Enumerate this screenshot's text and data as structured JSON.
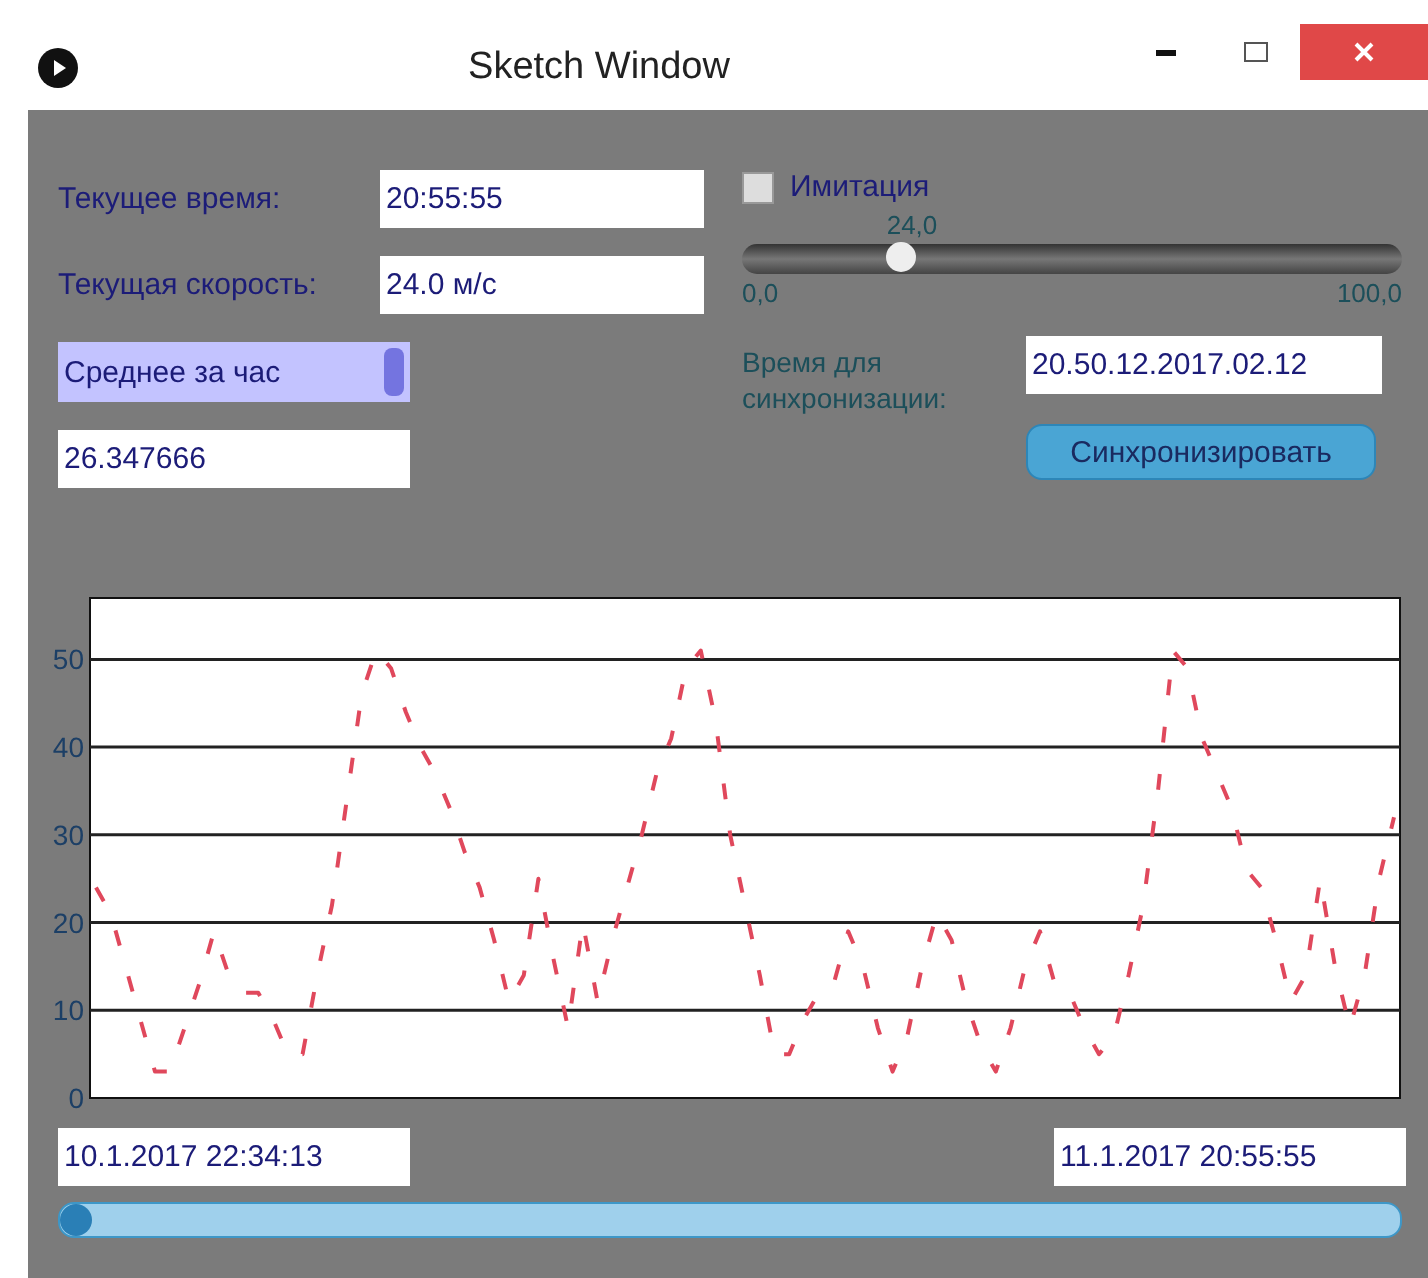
{
  "window": {
    "title": "Sketch Window"
  },
  "time": {
    "label": "Текущее время:",
    "value": "20:55:55"
  },
  "speed": {
    "label": "Текущая скорость:",
    "value": "24.0 м/с"
  },
  "average": {
    "mode": "Среднее за час",
    "value": "26.347666"
  },
  "imitation": {
    "label": "Имитация",
    "checked": false
  },
  "slider": {
    "reading": "24,0",
    "level": 0.24,
    "min_label": "0,0",
    "max_label": "100,0"
  },
  "sync": {
    "label": "Время для синхронизации:",
    "value": "20.50.12.2017.02.12",
    "button": "Синхронизировать"
  },
  "chart": {
    "chart_data": {
      "type": "line",
      "grid": true,
      "categories": [
        null,
        null,
        null,
        null,
        null,
        null,
        null,
        null,
        null,
        null,
        null,
        null,
        null,
        null,
        null,
        null,
        null,
        null,
        null,
        null,
        null,
        null,
        null,
        null,
        null,
        null,
        null,
        null,
        null,
        null,
        null,
        null,
        null,
        null,
        null,
        null,
        null,
        null,
        null,
        null,
        null,
        null,
        null,
        null,
        null,
        null,
        null,
        null,
        null,
        null,
        null,
        null,
        null,
        null,
        null,
        null,
        null,
        null,
        null,
        null,
        null,
        null,
        null,
        null,
        null,
        null,
        null,
        null,
        null,
        null,
        null,
        null,
        null,
        null,
        null,
        null,
        null,
        null,
        null,
        null,
        null,
        null,
        null,
        null,
        null,
        null,
        null,
        null,
        null
      ],
      "ylim": [
        0,
        57
      ],
      "yticks": [
        0,
        10,
        20,
        30,
        40,
        50
      ],
      "series": [
        {
          "color": "#e0485c",
          "line_style": "dotted",
          "values": [
            24,
            21,
            15,
            9,
            3,
            3,
            8,
            13,
            19,
            14,
            12,
            12,
            9,
            5,
            5,
            14,
            22,
            34,
            46,
            51,
            49,
            44,
            40,
            37,
            33,
            28,
            24,
            18,
            11,
            14,
            25,
            16,
            8,
            20,
            11,
            18,
            24,
            30,
            37,
            41,
            49,
            51,
            43,
            30,
            22,
            14,
            5,
            5,
            9,
            12,
            13,
            19,
            15,
            8,
            3,
            7,
            15,
            21,
            18,
            11,
            6,
            3,
            8,
            15,
            19,
            13,
            12,
            8,
            5,
            7,
            14,
            22,
            35,
            51,
            49,
            41,
            37,
            33,
            26,
            24,
            18,
            11,
            14,
            25,
            15,
            8,
            14,
            25,
            32
          ]
        }
      ]
    }
  },
  "range": {
    "start": "10.1.2017 22:34:13",
    "end": "11.1.2017 20:55:55"
  }
}
